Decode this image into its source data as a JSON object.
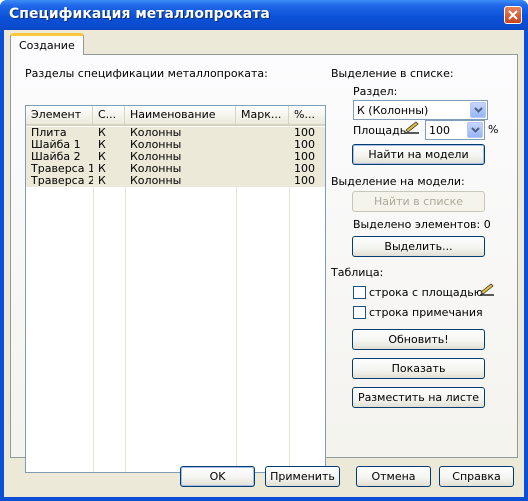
{
  "window": {
    "title": "Спецификация металлопроката"
  },
  "tabs": [
    {
      "label": "Создание"
    }
  ],
  "sections": {
    "list_label": "Разделы спецификации металлопроката:",
    "columns": [
      "Элемент",
      "С...",
      "Наименование",
      "Марк...",
      "%..."
    ],
    "rows": [
      [
        "Плита",
        "К",
        "Колонны",
        "",
        "100"
      ],
      [
        "Шайба 1",
        "К",
        "Колонны",
        "",
        "100"
      ],
      [
        "Шайба 2",
        "К",
        "Колонны",
        "",
        "100"
      ],
      [
        "Траверса 1",
        "К",
        "Колонны",
        "",
        "100"
      ],
      [
        "Траверса 2",
        "К",
        "Колонны",
        "",
        "100"
      ]
    ]
  },
  "selection_in_list": {
    "label": "Выделение в списке:",
    "section_label": "Раздел:",
    "section_value": "К (Колонны)",
    "area_label": "Площадь",
    "area_value": "100",
    "area_unit": "%",
    "find_on_model": "Найти на модели"
  },
  "selection_on_model": {
    "label": "Выделение на модели:",
    "find_in_list": "Найти в списке",
    "selected_count": "Выделено элементов: 0",
    "select_button": "Выделить..."
  },
  "table": {
    "label": "Таблица:",
    "row_with_area": "строка с площадью",
    "row_notes": "строка примечания",
    "refresh": "Обновить!",
    "show": "Показать",
    "place_on_sheet": "Разместить на листе"
  },
  "footer": {
    "ok": "OK",
    "apply": "Применить",
    "cancel": "Отмена",
    "help": "Справка"
  },
  "colors": {
    "titlebar": "#0a4fd6",
    "dialog_bg": "#ece9d8",
    "selection_row": "#ece9d8"
  }
}
